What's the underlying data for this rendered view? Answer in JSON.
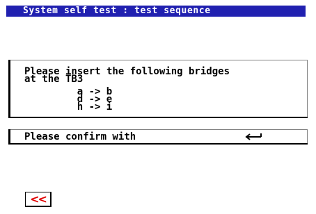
{
  "title": "System self test : test sequence",
  "message": {
    "line1": "Please insert the following bridges",
    "line2": "at the TB3",
    "bridges": [
      {
        "from": "a",
        "arrow": "->",
        "to": "b"
      },
      {
        "from": "d",
        "arrow": "->",
        "to": "e"
      },
      {
        "from": "h",
        "arrow": "->",
        "to": "i"
      }
    ]
  },
  "confirm": {
    "text": "Please confirm with",
    "icon": "enter-key-icon"
  },
  "back_button": {
    "label": "<<",
    "color": "#e00000"
  },
  "colors": {
    "title_bar": "#2020b0",
    "title_text": "#ffffff"
  }
}
